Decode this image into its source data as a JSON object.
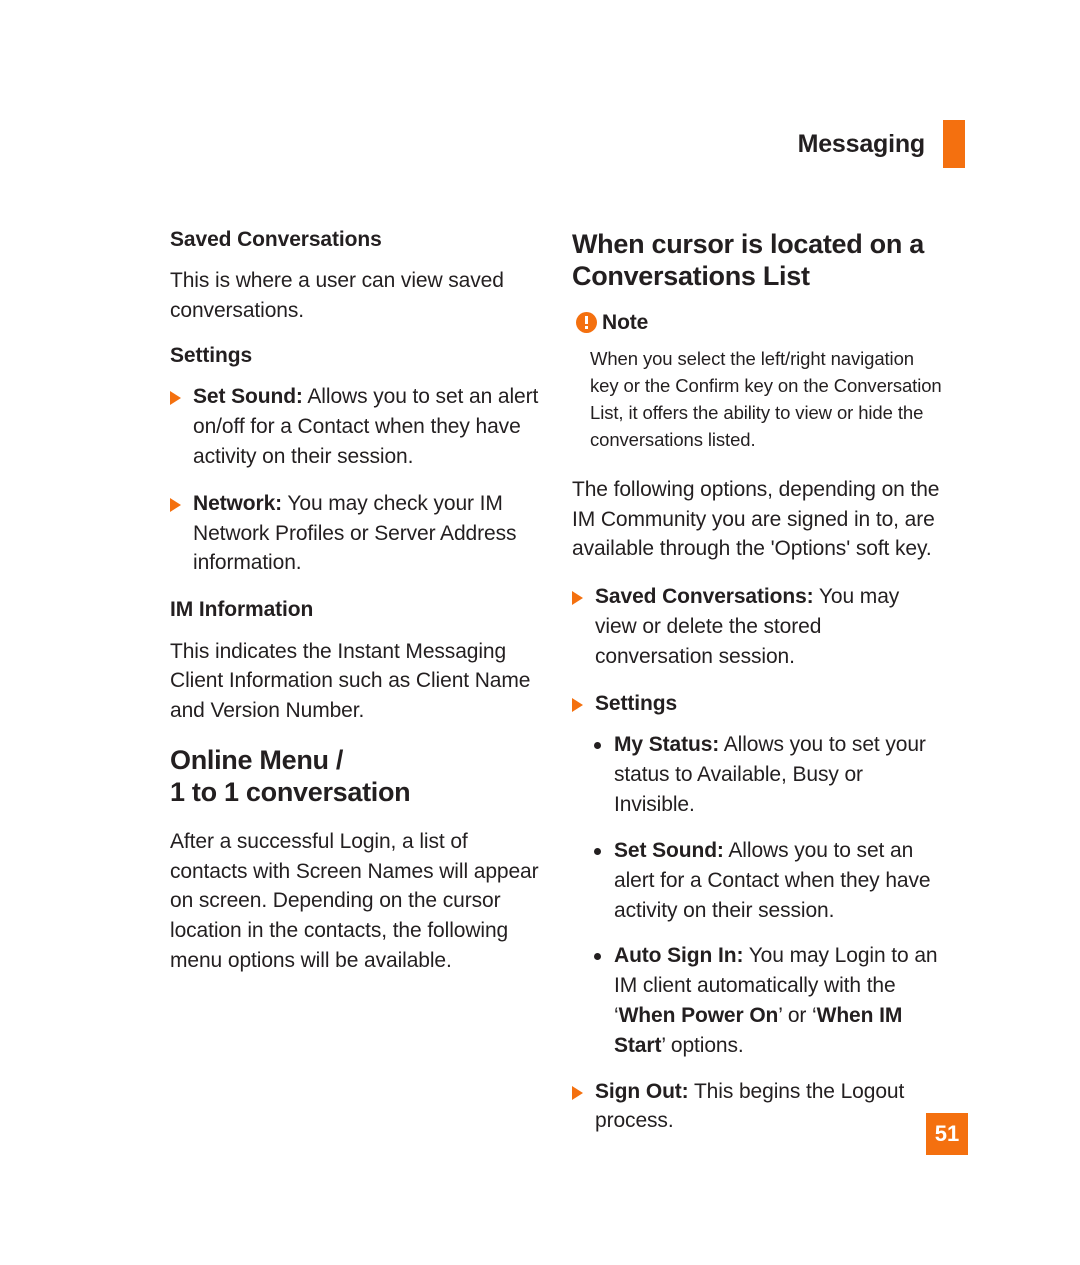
{
  "header": {
    "title": "Messaging",
    "tab_color": "#f4700f"
  },
  "left_column": {
    "saved_conversations_heading": "Saved Conversations",
    "saved_conversations_body": "This is where a user can view saved conversations.",
    "settings_heading": "Settings",
    "bullets": [
      {
        "term": "Set Sound:",
        "text": " Allows you to set an alert on/off for a Contact when they have activity on their session."
      },
      {
        "term": "Network:",
        "text": " You may check your IM Network Profiles or Server Address information."
      }
    ],
    "im_information_heading": "IM Information",
    "im_information_body": "This indicates the Instant Messaging Client Information such as Client Name and Version Number.",
    "online_menu_heading_line1": "Online Menu /",
    "online_menu_heading_line2": "1 to 1 conversation",
    "online_menu_body": "After a successful Login, a list of contacts with Screen Names will appear on screen. Depending on the cursor location in the contacts, the following menu options will be available."
  },
  "right_column": {
    "heading_line1": "When cursor is located on a",
    "heading_line2": "Conversations List",
    "note": {
      "label": "Note",
      "body": "When you select the left/right navigation key or the Confirm key on the Conversation List, it offers the ability to view or hide the conversations listed."
    },
    "intro_body": "The following options, depending on the IM Community you are signed in to, are available through the 'Options' soft key.",
    "saved_conversations_bullet": {
      "term": "Saved Conversations:",
      "text": " You may view or delete the stored conversation session."
    },
    "settings_bullet_label": "Settings",
    "settings_sub_bullets": [
      {
        "term": "My Status:",
        "text": " Allows you to set your status to Available, Busy or Invisible."
      },
      {
        "term": "Set Sound:",
        "text": " Allows you to set an alert for a Contact when they have activity on their session."
      }
    ],
    "auto_sign_in": {
      "term": "Auto Sign In:",
      "text_part1": " You may Login to an IM client automatically with the ‘",
      "bold1": "When Power On",
      "text_part2": "’ or ‘",
      "bold2": "When IM Start",
      "text_part3": "’ options."
    },
    "sign_out_bullet": {
      "term": "Sign Out:",
      "text": " This begins the Logout process."
    }
  },
  "footer": {
    "page_number": "51"
  }
}
